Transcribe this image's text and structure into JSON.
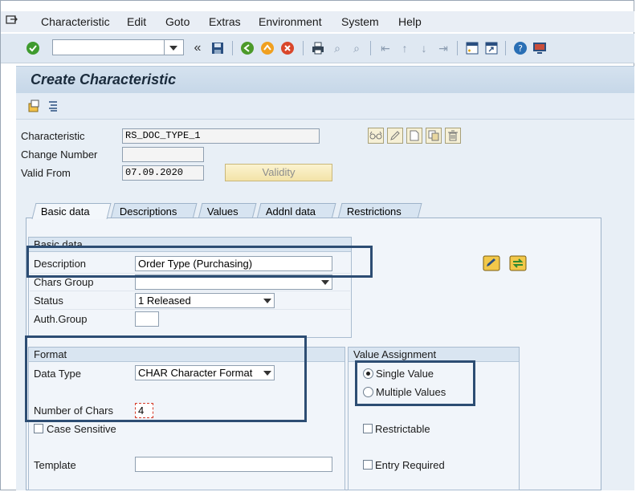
{
  "menu": {
    "items": [
      "Characteristic",
      "Edit",
      "Goto",
      "Extras",
      "Environment",
      "System",
      "Help"
    ]
  },
  "toolbar": {
    "command_field_value": "",
    "icons": [
      "check-icon",
      "command-dropdown",
      "back-double-icon",
      "save-icon",
      "back-icon",
      "exit-icon",
      "cancel-icon",
      "print-icon",
      "find-icon",
      "find-next-icon",
      "first-page-icon",
      "prev-page-icon",
      "next-page-icon",
      "last-page-icon",
      "create-session-icon",
      "shortcut-icon",
      "help-icon",
      "customize-icon"
    ]
  },
  "title": "Create Characteristic",
  "header": {
    "characteristic_label": "Characteristic",
    "characteristic_value": "RS_DOC_TYPE_1",
    "change_number_label": "Change Number",
    "change_number_value": "",
    "valid_from_label": "Valid From",
    "valid_from_value": "07.09.2020",
    "validity_button": "Validity"
  },
  "tabs": [
    {
      "label": "Basic data",
      "active": true
    },
    {
      "label": "Descriptions",
      "active": false
    },
    {
      "label": "Values",
      "active": false
    },
    {
      "label": "Addnl data",
      "active": false
    },
    {
      "label": "Restrictions",
      "active": false
    }
  ],
  "basic_data": {
    "group_title": "Basic data",
    "description_label": "Description",
    "description_value": "Order Type (Purchasing)",
    "chars_group_label": "Chars Group",
    "chars_group_value": "",
    "status_label": "Status",
    "status_value": "1 Released",
    "auth_group_label": "Auth.Group",
    "auth_group_value": ""
  },
  "format": {
    "group_title": "Format",
    "data_type_label": "Data Type",
    "data_type_value": "CHAR Character Format",
    "number_of_chars_label": "Number of Chars",
    "number_of_chars_value": "4",
    "case_sensitive_label": "Case Sensitive",
    "case_sensitive_checked": false,
    "template_label": "Template",
    "template_value": ""
  },
  "value_assignment": {
    "group_title": "Value Assignment",
    "single_value_label": "Single Value",
    "multiple_values_label": "Multiple Values",
    "selected": "Single Value",
    "restrictable_label": "Restrictable",
    "entry_required_label": "Entry Required"
  },
  "colors": {
    "highlight_border": "#2d4d73",
    "validity_button_bg": "#f3e3a8",
    "title_color": "#1a2b3c"
  }
}
